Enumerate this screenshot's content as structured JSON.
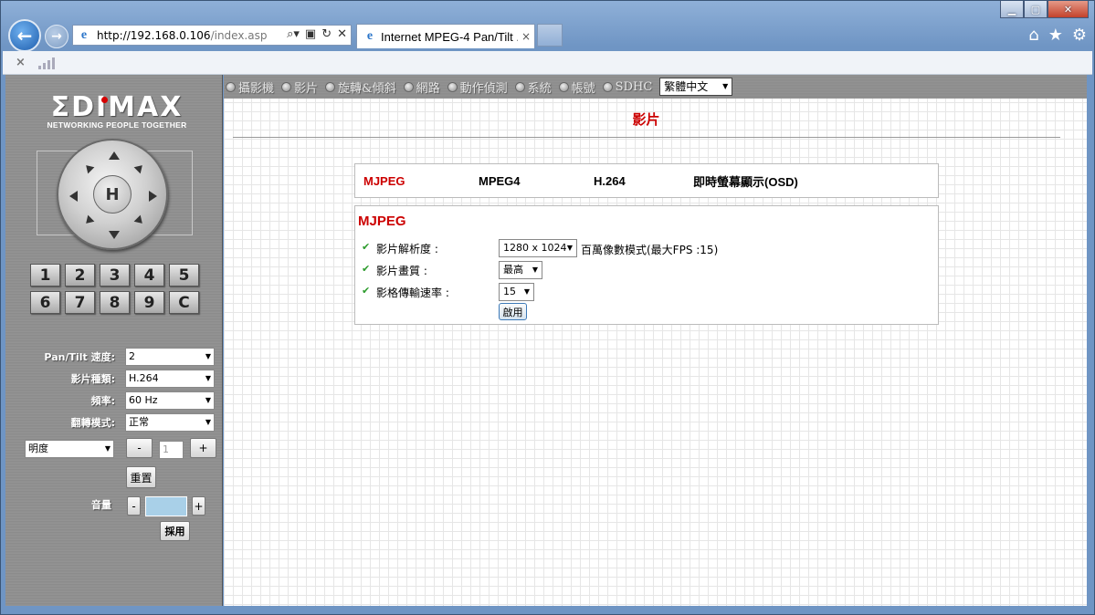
{
  "window": {
    "minimize_icon": "minimize-icon",
    "maximize_icon": "maximize-icon",
    "close_icon": "close-icon"
  },
  "browser": {
    "url_host": "http://192.168.0.106",
    "url_path": "/index.asp",
    "tab_title": "Internet MPEG-4 Pan/Tilt ...",
    "tab_close": "×",
    "cmd_close": "×",
    "home_icon": "⌂",
    "star_icon": "★",
    "gear_icon": "⚙"
  },
  "sidebar": {
    "logo_text": "ΣDIMAX",
    "logo_tagline": "NETWORKING PEOPLE TOGETHER",
    "ptz_home_label": "H",
    "presets": [
      "1",
      "2",
      "3",
      "4",
      "5",
      "6",
      "7",
      "8",
      "9",
      "C"
    ],
    "pan_tilt_speed_label": "Pan/Tilt 速度:",
    "pan_tilt_speed_value": "2",
    "video_type_label": "影片種類:",
    "video_type_value": "H.264",
    "frequency_label": "頻率:",
    "frequency_value": "60 Hz",
    "flip_mode_label": "翻轉模式:",
    "flip_mode_value": "正常",
    "brightness_select": "明度",
    "brightness_minus": "-",
    "brightness_value": "1",
    "brightness_plus": "+",
    "reset_button": "重置",
    "volume_label": "音量",
    "volume_minus": "-",
    "volume_plus": "+",
    "apply_button": "採用"
  },
  "menu": {
    "items": [
      "攝影機",
      "影片",
      "旋轉&傾斜",
      "網路",
      "動作偵測",
      "系統",
      "帳號",
      "SDHC"
    ],
    "language": "繁體中文"
  },
  "main": {
    "page_title": "影片",
    "subtabs": [
      "MJPEG",
      "MPEG4",
      "H.264",
      "即時螢幕顯示(OSD)"
    ],
    "section_title": "MJPEG",
    "resolution_label": "影片解析度 :",
    "resolution_value": "1280 x 1024",
    "resolution_note": "百萬像數模式(最大FPS :15)",
    "quality_label": "影片畫質 :",
    "quality_value": "最高",
    "frame_rate_label": "影格傳輸速率 :",
    "frame_rate_value": "15",
    "apply_button": "啟用"
  }
}
